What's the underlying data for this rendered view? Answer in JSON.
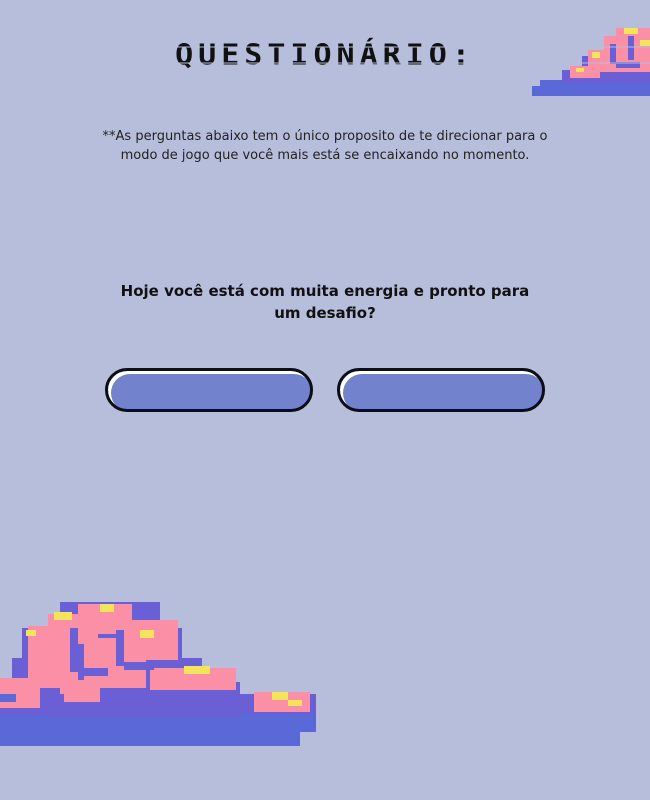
{
  "header": {
    "title": "Questionário:"
  },
  "intro": {
    "disclaimer": "**As perguntas abaixo tem o único proposito de te direcionar para o modo de jogo que você mais está se encaixando no momento."
  },
  "quiz": {
    "question": "Hoje você está com muita energia e pronto para um desafio?",
    "answers": [
      {
        "label": ""
      },
      {
        "label": ""
      }
    ]
  },
  "decorations": {
    "cloud_top_icon": "pixel-cloud",
    "cloud_bottom_icon": "pixel-cloud"
  },
  "colors": {
    "background": "#b7bedb",
    "button_fill": "#7282cd",
    "button_border": "#0d0d14",
    "cloud_pink": "#fa8fa6",
    "cloud_yellow": "#f4e45c",
    "cloud_purple": "#6b5fd6",
    "cloud_blue": "#5b68d8"
  }
}
